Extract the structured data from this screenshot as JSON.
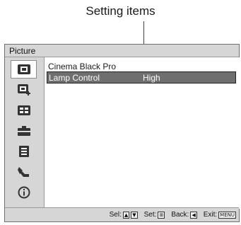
{
  "callout": {
    "label": "Setting items"
  },
  "menu": {
    "title": "Picture",
    "icons": [
      {
        "name": "picture-icon",
        "active": true
      },
      {
        "name": "advanced-picture-icon",
        "active": false
      },
      {
        "name": "screen-icon",
        "active": false
      },
      {
        "name": "setup-icon",
        "active": false
      },
      {
        "name": "function-icon",
        "active": false
      },
      {
        "name": "installation-icon",
        "active": false
      },
      {
        "name": "information-icon",
        "active": false
      }
    ],
    "items": [
      {
        "label": "Cinema Black Pro",
        "value": "",
        "selected": false
      },
      {
        "label": "Lamp Control",
        "value": "High",
        "selected": true
      }
    ],
    "footer": {
      "sel_label": "Sel:",
      "sel_keys": [
        "▲",
        "▼"
      ],
      "set_label": "Set:",
      "set_key": "⊞",
      "back_label": "Back:",
      "back_key": "◀",
      "exit_label": "Exit:",
      "exit_key": "MENU"
    }
  }
}
